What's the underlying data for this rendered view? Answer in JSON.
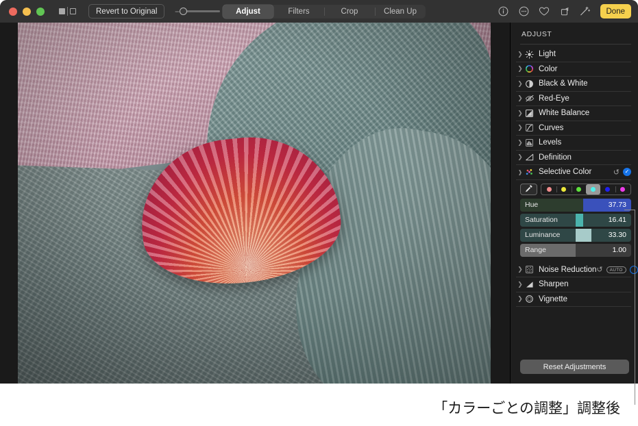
{
  "window": {
    "traffic_lights": [
      "close",
      "minimize",
      "zoom"
    ],
    "compare_icon": "split-view-icon",
    "revert_label": "Revert to Original",
    "zoom_slider": {
      "minus": "−",
      "plus": "+",
      "value": 0
    }
  },
  "tabs": [
    {
      "label": "Adjust",
      "active": true
    },
    {
      "label": "Filters",
      "active": false
    },
    {
      "label": "Crop",
      "active": false
    },
    {
      "label": "Clean Up",
      "active": false
    }
  ],
  "toolbar_icons": [
    {
      "name": "info-icon",
      "glyph": "ⓘ"
    },
    {
      "name": "more-options-icon",
      "glyph": "⋯"
    },
    {
      "name": "favorite-heart-icon",
      "glyph": "♡"
    },
    {
      "name": "rotate-icon",
      "glyph": "↻"
    },
    {
      "name": "auto-enhance-wand-icon",
      "glyph": "✦"
    }
  ],
  "done_label": "Done",
  "sidebar": {
    "title": "ADJUST",
    "items": [
      {
        "label": "Light",
        "icon": "sun-brightness-icon",
        "expanded": false
      },
      {
        "label": "Color",
        "icon": "color-wheel-icon",
        "expanded": false
      },
      {
        "label": "Black & White",
        "icon": "half-circle-contrast-icon",
        "expanded": false
      },
      {
        "label": "Red-Eye",
        "icon": "eye-slash-icon",
        "expanded": false
      },
      {
        "label": "White Balance",
        "icon": "white-balance-icon",
        "expanded": false
      },
      {
        "label": "Curves",
        "icon": "curves-icon",
        "expanded": false
      },
      {
        "label": "Levels",
        "icon": "levels-histogram-icon",
        "expanded": false
      },
      {
        "label": "Definition",
        "icon": "definition-triangle-icon",
        "expanded": false
      },
      {
        "label": "Selective Color",
        "icon": "selective-color-dots-icon",
        "expanded": true,
        "revert": "↺",
        "checked": true
      },
      {
        "label": "Noise Reduction",
        "icon": "noise-reduction-icon",
        "expanded": false,
        "revert": "↺",
        "auto_badge": "AUTO",
        "checked": false
      },
      {
        "label": "Sharpen",
        "icon": "sharpen-triangle-icon",
        "expanded": false
      },
      {
        "label": "Vignette",
        "icon": "vignette-circle-icon",
        "expanded": false
      }
    ],
    "selective_color": {
      "eyedropper": "eyedropper-icon",
      "swatches": [
        {
          "name": "red",
          "color": "#f08c8c",
          "selected": false
        },
        {
          "name": "yellow",
          "color": "#ece83a",
          "selected": false
        },
        {
          "name": "green",
          "color": "#5ee03c",
          "selected": false
        },
        {
          "name": "cyan",
          "color": "#4ff0ea",
          "selected": true
        },
        {
          "name": "blue",
          "color": "#2020ef",
          "selected": false
        },
        {
          "name": "magenta",
          "color": "#ee3ce8",
          "selected": false
        }
      ],
      "sliders": [
        {
          "label": "Hue",
          "value": "37.73",
          "pct": 57,
          "track": "#2d3d2e",
          "fill": "#3a51bb"
        },
        {
          "label": "Saturation",
          "value": "16.41",
          "pct": 57,
          "track": "#2f4746",
          "fill": "#4bb3ad",
          "handle_start": 50
        },
        {
          "label": "Luminance",
          "value": "33.30",
          "pct": 64,
          "track": "#2f4746",
          "fill": "#a7cbc9",
          "handle_start": 50
        },
        {
          "label": "Range",
          "value": "1.00",
          "pct": 50,
          "track": "#3c3c3c",
          "fill": "#6b6b6b"
        }
      ]
    },
    "reset_label": "Reset Adjustments"
  },
  "caption": "「カラーごとの調整」調整後",
  "colors": {
    "accent_done": "#f5d04d",
    "accent_blue": "#1673e8",
    "toolbar_bg": "#323232",
    "sidebar_bg": "#1e1e1e",
    "canvas_bg": "#1a1a1a"
  }
}
